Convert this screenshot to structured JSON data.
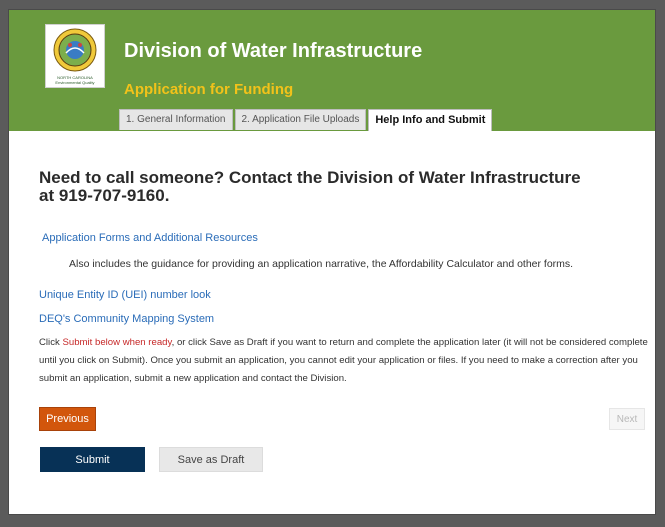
{
  "header": {
    "title": "Division of Water Infrastructure",
    "subtitle": "Application for Funding",
    "logo_text": "NORTH CAROLINA Environmental Quality",
    "colors": {
      "banner": "#6a9a3e",
      "subtitle": "#f2c21a"
    }
  },
  "tabs": [
    {
      "label": "1. General Information",
      "active": false
    },
    {
      "label": "2. Application File Uploads",
      "active": false
    },
    {
      "label": "Help Info and Submit",
      "active": true
    }
  ],
  "content": {
    "heading": "Need to call someone? Contact the Division of Water Infrastructure at 919-707-9160.",
    "links": {
      "forms": "Application Forms and Additional Resources",
      "uei": "Unique Entity ID (UEI) number look",
      "mapping": "DEQ's Community Mapping System"
    },
    "forms_note": "Also includes the guidance for providing an application narrative, the Affordability Calculator and other forms.",
    "instructions": {
      "part1": "Click ",
      "part2_red": "Submit below when ready",
      "part3": ", or click Save as Draft if you want to return and complete the application later (it will not be considered complete until you click on Submit). Once you submit an application, you cannot edit your application or files. If you need to make a correction after you submit an application, submit a new application and contact the Division."
    }
  },
  "buttons": {
    "previous": "Previous",
    "next": "Next",
    "submit": "Submit",
    "save_draft": "Save as Draft"
  }
}
